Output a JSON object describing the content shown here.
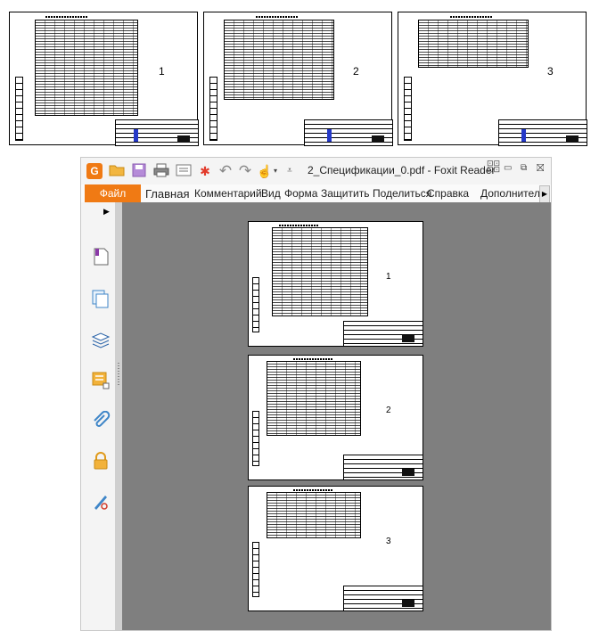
{
  "preview": {
    "pages": [
      {
        "number": "1"
      },
      {
        "number": "2"
      },
      {
        "number": "3"
      }
    ]
  },
  "window": {
    "title": "2_Спецификации_0.pdf - Foxit Reader",
    "accent_color": "#f07a14",
    "quick_access_icons": [
      "foxit-logo-icon",
      "open-folder-icon",
      "save-icon",
      "print-icon",
      "scan-icon",
      "new-icon",
      "undo-icon",
      "redo-icon",
      "hand-tool-icon",
      "customize-dropdown-icon"
    ],
    "controls": [
      "ribbon-toggle-icon",
      "minimize-icon",
      "restore-icon",
      "close-icon"
    ]
  },
  "menu": {
    "file": "Файл",
    "items": [
      "Главная",
      "Комментарий",
      "Вид",
      "Форма",
      "Защитить",
      "Поделиться",
      "Справка",
      "Дополнитель"
    ]
  },
  "sidebar": {
    "tools": [
      "bookmark-icon",
      "pages-icon",
      "layers-icon",
      "comments-icon",
      "attachments-icon",
      "security-icon",
      "signature-icon"
    ]
  },
  "document": {
    "pages": [
      {
        "number": "1"
      },
      {
        "number": "2"
      },
      {
        "number": "3"
      }
    ]
  }
}
